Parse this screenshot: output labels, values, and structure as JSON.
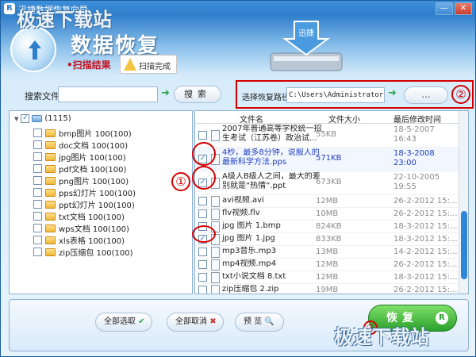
{
  "window": {
    "title": "迅捷数据恢复向导",
    "app_icon_letter": "R",
    "minimize": "—",
    "close": "✕"
  },
  "header": {
    "main_title": "数据恢复",
    "scan_result": "•扫描结果",
    "scan_done": "扫描完成",
    "drive_label": "迅捷"
  },
  "toolbar": {
    "search_label": "搜索文件:",
    "search_value": "",
    "search_button": "搜索",
    "restore_path_label": "选择恢复路径",
    "restore_path_value": "C:\\Users\\Administrator\\Desk",
    "browse_button": "...",
    "annotation_2": "②"
  },
  "tree": {
    "root_label": "(1115)",
    "items": [
      {
        "label": "bmp图片 100(100)"
      },
      {
        "label": "doc文档 100(100)"
      },
      {
        "label": "jpg图片 100(100)"
      },
      {
        "label": "pdf文档 100(100)"
      },
      {
        "label": "png图片 100(100)"
      },
      {
        "label": "pps幻灯片 100(100)"
      },
      {
        "label": "ppt幻灯片 100(100)"
      },
      {
        "label": "txt文档 100(100)"
      },
      {
        "label": "wps文档 100(100)"
      },
      {
        "label": "xls表格 100(100)"
      },
      {
        "label": "zip压缩包 100(100)"
      }
    ]
  },
  "files": {
    "col_name": "文件名",
    "col_size": "文件大小",
    "col_time": "最后修改时间",
    "rows": [
      {
        "name": "2007年普通高等学校统一招生考试（江苏卷）政治试...",
        "size": "55KB",
        "time": "18-5-2007\n16:43",
        "checked": false,
        "selected": false
      },
      {
        "name": "4秒，最多8分钟，说服人的最新科学方法.pps",
        "size": "571KB",
        "time": "18-3-2008\n23:00",
        "checked": true,
        "selected": true
      },
      {
        "name": "A级人B级人之间，最大的差别就是“热情”.ppt",
        "size": "673KB",
        "time": "22-10-2005\n19:55",
        "checked": true,
        "selected": false
      },
      {
        "name": "avi视频.avi",
        "size": "12MB",
        "time": "26-2-2012 15:...",
        "checked": false,
        "selected": false
      },
      {
        "name": "flv视频.flv",
        "size": "10MB",
        "time": "26-2-2012 15:...",
        "checked": false,
        "selected": false
      },
      {
        "name": "jpg 图片 1.bmp",
        "size": "824KB",
        "time": "18-3-2012 15:...",
        "checked": false,
        "selected": false
      },
      {
        "name": "jpg 图片 1.jpg",
        "size": "833KB",
        "time": "18-3-2012 15:...",
        "checked": true,
        "selected": false
      },
      {
        "name": "mp3音乐.mp3",
        "size": "13MB",
        "time": "14-2-2012 15:...",
        "checked": false,
        "selected": false
      },
      {
        "name": "mp4视频.mp4",
        "size": "12MB",
        "time": "26-2-2012 15:...",
        "checked": false,
        "selected": false
      },
      {
        "name": "txt小说文档 8.txt",
        "size": "12MB",
        "time": "18-3-2012 15:...",
        "checked": false,
        "selected": false
      },
      {
        "name": "zip压缩包 2.zip",
        "size": "19MB",
        "time": "26-2-2012 15:...",
        "checked": false,
        "selected": false
      }
    ],
    "annotation_1": "①"
  },
  "bottom": {
    "select_all": "全部选取",
    "deselect_all": "全部取消",
    "preview": "预 览",
    "restore": "恢复",
    "restore_r": "R",
    "annotation_3": "③"
  },
  "watermark": "极速下载站",
  "colors": {
    "accent_blue": "#2f7fcc",
    "annotation_red": "#d40000",
    "restore_green": "#2aa02a",
    "selected_text": "#1f3fbf"
  }
}
